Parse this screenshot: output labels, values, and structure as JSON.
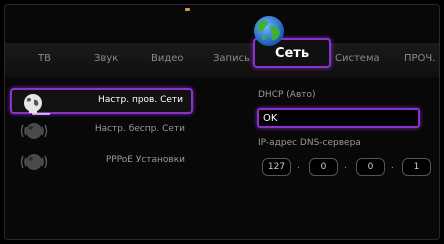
{
  "tabs": [
    {
      "label": "ТВ"
    },
    {
      "label": "Звук"
    },
    {
      "label": "Видео"
    },
    {
      "label": "Запись"
    },
    {
      "label": "Сеть"
    },
    {
      "label": "Система"
    },
    {
      "label": "ПРОЧ."
    }
  ],
  "active_tab_icon": "globe-icon",
  "sidebar": {
    "items": [
      {
        "label": "Настр. пров. Сети",
        "icon": "wired-network-icon"
      },
      {
        "label": "Настр. беспр. Сети",
        "icon": "wireless-network-icon"
      },
      {
        "label": "PPPoE Установки",
        "icon": "pppoe-icon"
      }
    ]
  },
  "panel": {
    "dhcp_label": "DHCP (Авто)",
    "status_value": "OK",
    "dns_label": "IP-адрес DNS-сервера",
    "dns_octets": [
      "127",
      "0",
      "0",
      "1"
    ],
    "separator": "."
  },
  "colors": {
    "highlight": "#8a33c9",
    "background": "#080808"
  }
}
